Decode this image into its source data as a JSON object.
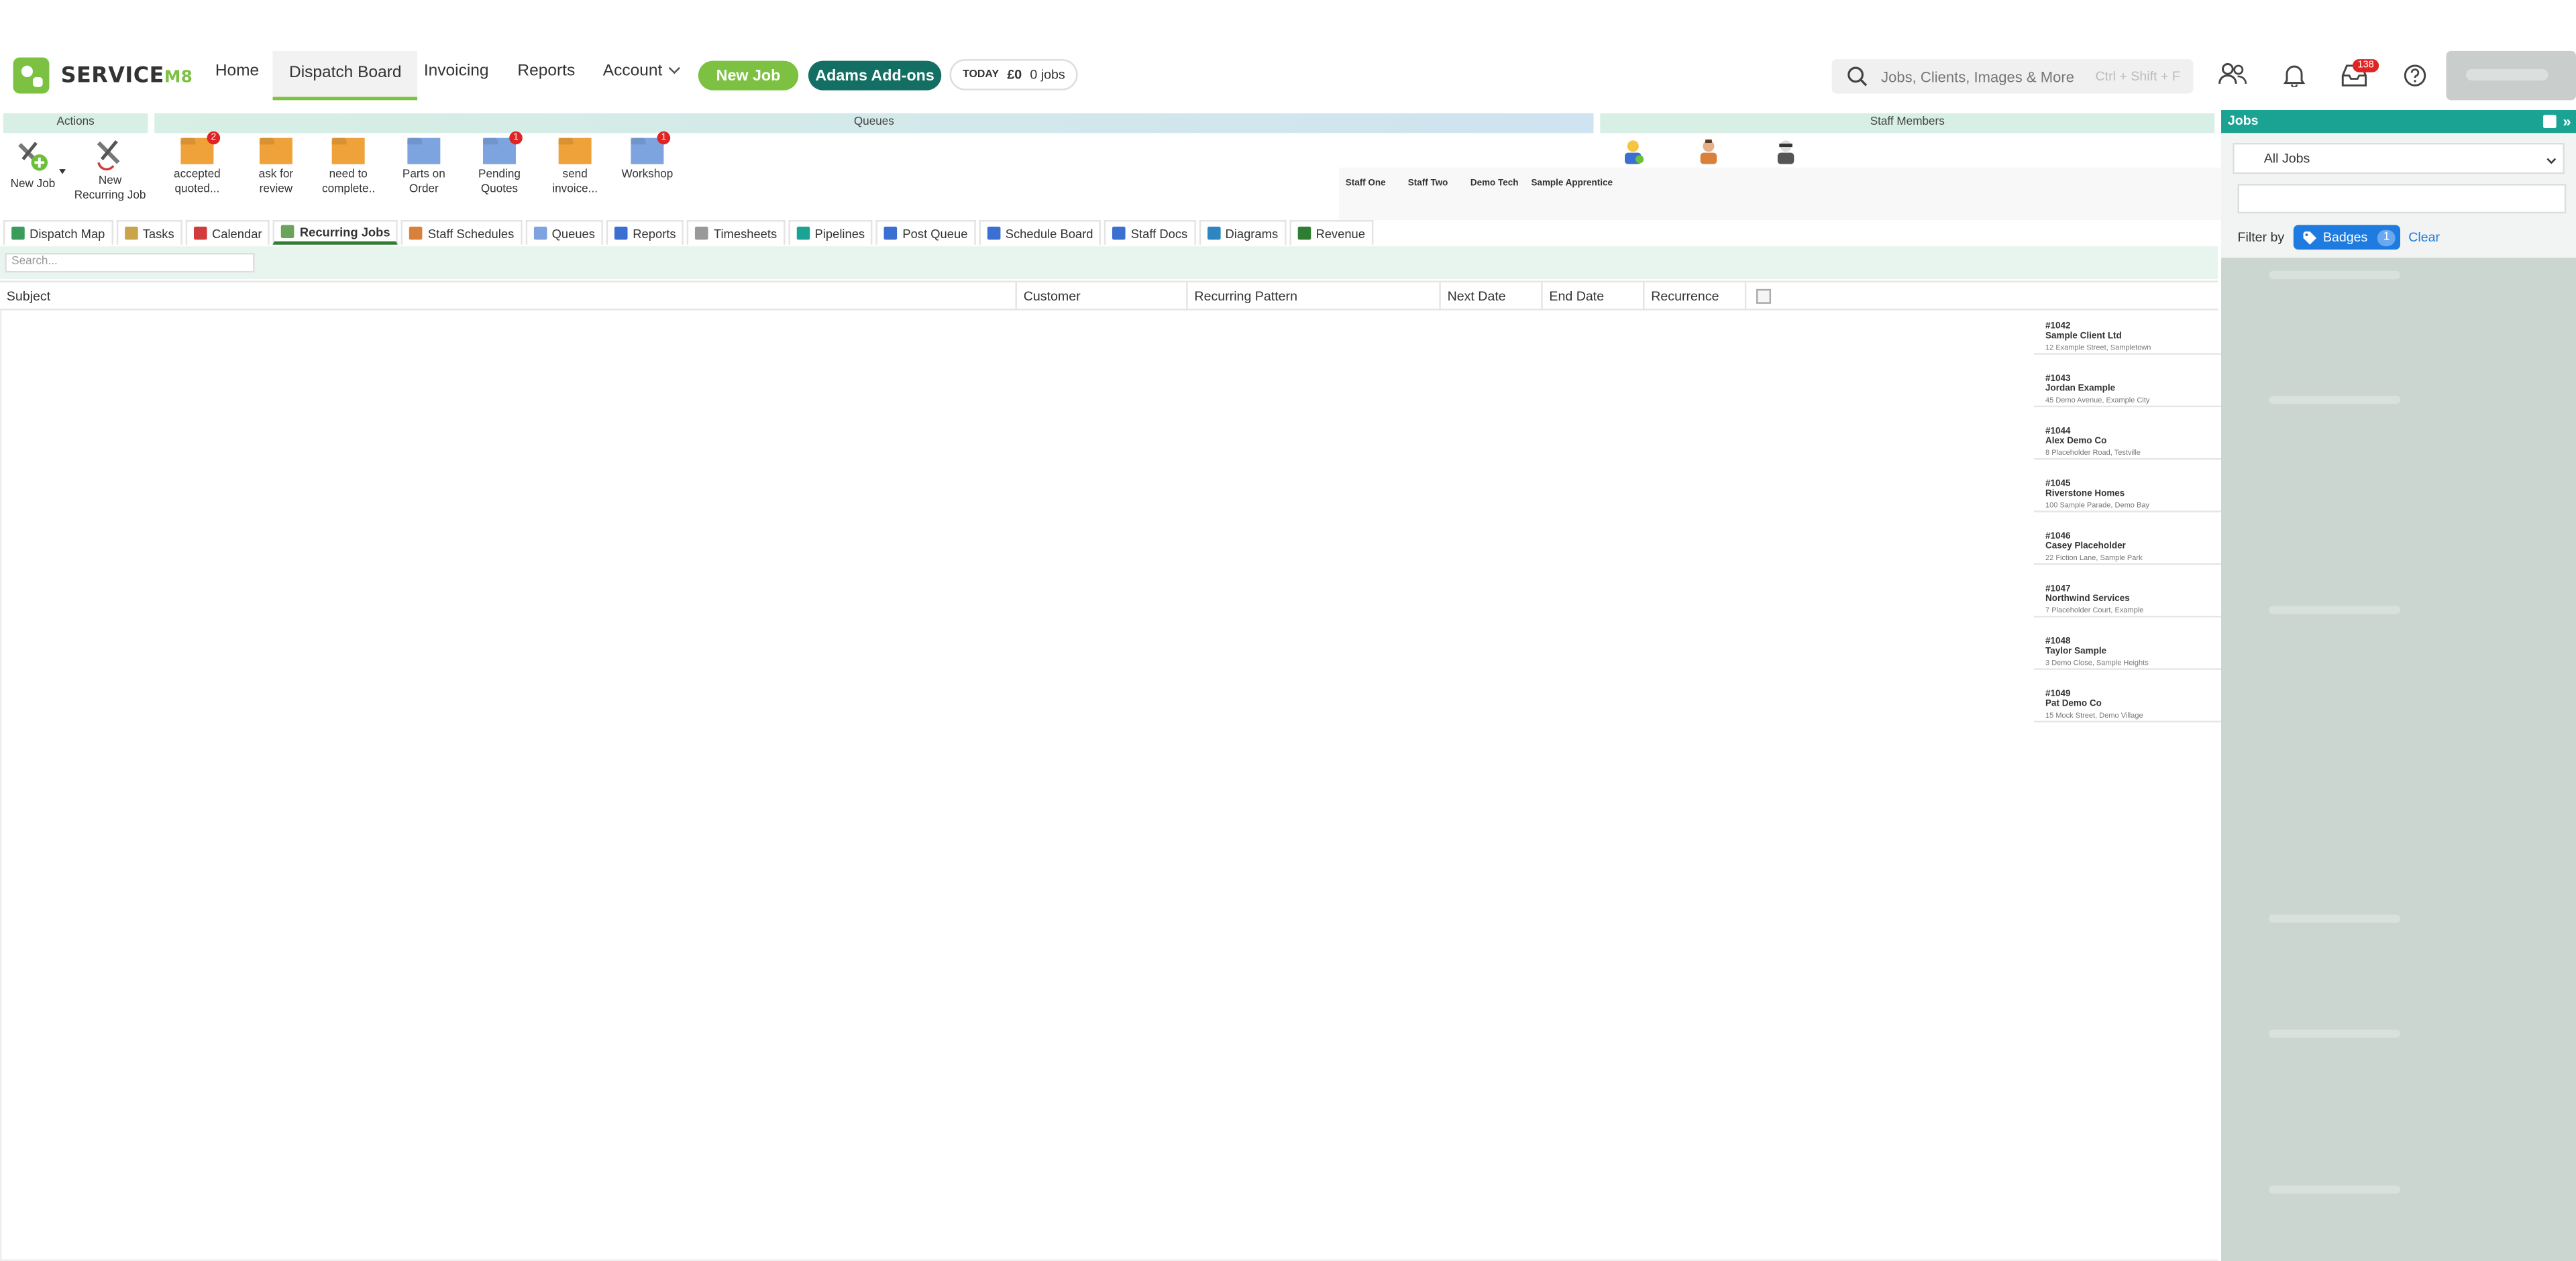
{
  "app": {
    "brand": "SERVICE",
    "brand_suffix": "M8"
  },
  "nav": {
    "home": "Home",
    "dispatch_board": "Dispatch Board",
    "invoicing": "Invoicing",
    "reports": "Reports",
    "account": "Account",
    "new_job": "New Job",
    "addons": "Adams Add-ons",
    "today_label": "TODAY",
    "today_amount": "£0",
    "today_jobs": "0 jobs",
    "search_placeholder": "Jobs, Clients, Images & More",
    "search_shortcut": "Ctrl + Shift + F",
    "inbox_count": "138"
  },
  "panels": {
    "actions": "Actions",
    "queues": "Queues",
    "staff_members": "Staff Members"
  },
  "actions": [
    {
      "label": "New Job"
    },
    {
      "label": "New Recurring Job"
    }
  ],
  "queues": [
    {
      "label": "accepted quoted...",
      "badge": "2",
      "color": "#f0a23a"
    },
    {
      "label": "ask for review",
      "badge": "",
      "color": "#f0a23a"
    },
    {
      "label": "need to complete..",
      "badge": "",
      "color": "#f0a23a"
    },
    {
      "label": "Parts on Order",
      "badge": "",
      "color": "#7ea4e0"
    },
    {
      "label": "Pending Quotes",
      "badge": "1",
      "color": "#7ea4e0"
    },
    {
      "label": "send invoice...",
      "badge": "",
      "color": "#f0a23a"
    },
    {
      "label": "Workshop",
      "badge": "1",
      "color": "#7ea4e0"
    }
  ],
  "staff": [
    "Staff One",
    "Staff Two",
    "Demo Tech",
    "Sample Apprentice"
  ],
  "tabs": [
    {
      "label": "Dispatch Map",
      "color": "#3a9b5b"
    },
    {
      "label": "Tasks",
      "color": "#c9a44a"
    },
    {
      "label": "Calendar",
      "color": "#d13b3b"
    },
    {
      "label": "Recurring Jobs",
      "color": "#6ba35a"
    },
    {
      "label": "Staff Schedules",
      "color": "#d9803b"
    },
    {
      "label": "Queues",
      "color": "#7ea4e0"
    },
    {
      "label": "Reports",
      "color": "#3b6fd1"
    },
    {
      "label": "Timesheets",
      "color": "#999999"
    },
    {
      "label": "Pipelines",
      "color": "#1aa392"
    },
    {
      "label": "Post Queue",
      "color": "#3b6fd1"
    },
    {
      "label": "Schedule Board",
      "color": "#3b6fd1"
    },
    {
      "label": "Staff Docs",
      "color": "#3b6fd1"
    },
    {
      "label": "Diagrams",
      "color": "#2e86c1"
    },
    {
      "label": "Revenue",
      "color": "#2e7d32"
    }
  ],
  "grid": {
    "search_placeholder": "Search...",
    "columns": [
      "Subject",
      "Customer",
      "Recurring Pattern",
      "Next Date",
      "End Date",
      "Recurrence"
    ]
  },
  "jobs_overlay": [
    {
      "num": "#1042",
      "client": "Sample Client Ltd",
      "addr": "12 Example Street, Sampletown"
    },
    {
      "num": "#1043",
      "client": "Jordan Example",
      "addr": "45 Demo Avenue, Example City"
    },
    {
      "num": "#1044",
      "client": "Alex Demo Co",
      "addr": "8 Placeholder Road, Testville"
    },
    {
      "num": "#1045",
      "client": "Riverstone Homes",
      "addr": "100 Sample Parade, Demo Bay"
    },
    {
      "num": "#1046",
      "client": "Casey Placeholder",
      "addr": "22 Fiction Lane, Sample Park"
    },
    {
      "num": "#1047",
      "client": "Northwind Services",
      "addr": "7 Placeholder Court, Example"
    },
    {
      "num": "#1048",
      "client": "Taylor Sample",
      "addr": "3 Demo Close, Sample Heights"
    },
    {
      "num": "#1049",
      "client": "Pat Demo Co",
      "addr": "15 Mock Street, Demo Village"
    }
  ],
  "right_panel": {
    "title": "Jobs",
    "select_value": "All Jobs",
    "filter_by": "Filter by",
    "chip_label": "Badges",
    "chip_count": "1",
    "clear": "Clear"
  }
}
